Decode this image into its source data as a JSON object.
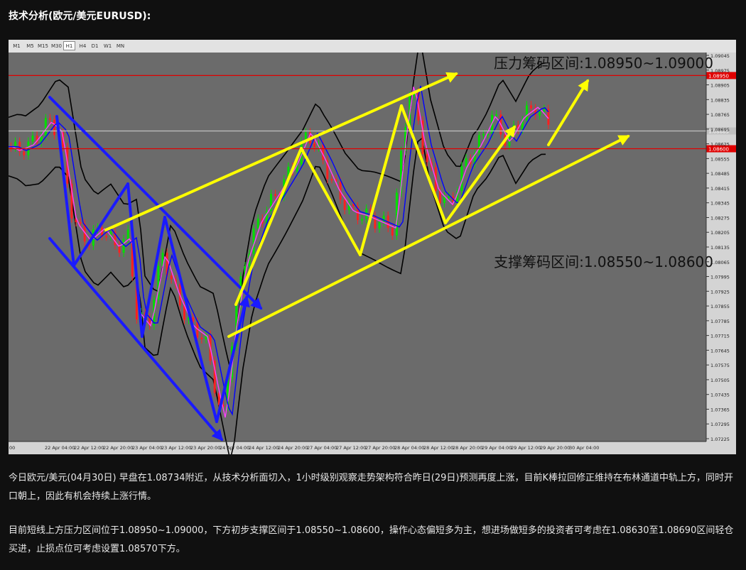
{
  "heading": "技术分析(欧元/美元EURUSD):",
  "timeframes": [
    {
      "label": "M1",
      "active": false
    },
    {
      "label": "M5",
      "active": false
    },
    {
      "label": "M15",
      "active": false
    },
    {
      "label": "M30",
      "active": false
    },
    {
      "label": "H1",
      "active": true
    },
    {
      "label": "H4",
      "active": false
    },
    {
      "label": "D1",
      "active": false
    },
    {
      "label": "W1",
      "active": false
    },
    {
      "label": "MN",
      "active": false
    }
  ],
  "chart_data": {
    "type": "line",
    "resistance_label": "压力筹码区间:1.08950~1.09000",
    "support_label": "支撑筹码区间:1.08550~1.08600",
    "price_ticks": [
      "1.09045",
      "1.08975",
      "1.08905",
      "1.08835",
      "1.08765",
      "1.08695",
      "1.08625",
      "1.08555",
      "1.08485",
      "1.08415",
      "1.08345",
      "1.08275",
      "1.08205",
      "1.08135",
      "1.08065",
      "1.07995",
      "1.07925",
      "1.07855",
      "1.07785",
      "1.07715",
      "1.07645",
      "1.07575",
      "1.07505",
      "1.07435",
      "1.07365",
      "1.07295",
      "1.07225"
    ],
    "y_range": [
      1.072,
      1.0906
    ],
    "time_ticks": [
      "00",
      "22 Apr 04:00",
      "22 Apr 12:00",
      "22 Apr 20:00",
      "23 Apr 04:00",
      "23 Apr 12:00",
      "23 Apr 20:00",
      "24 Apr 04:00",
      "24 Apr 12:00",
      "24 Apr 20:00",
      "27 Apr 04:00",
      "27 Apr 12:00",
      "27 Apr 20:00",
      "28 Apr 04:00",
      "28 Apr 12:00",
      "28 Apr 20:00",
      "29 Apr 04:00",
      "29 Apr 12:00",
      "29 Apr 20:00",
      "30 Apr 04:00"
    ],
    "hlines": [
      {
        "price": 1.0895,
        "label": "1.08950",
        "color": "#e00000"
      },
      {
        "price": 1.086,
        "label": "1.08600",
        "color": "#e00000"
      },
      {
        "price": 1.08685,
        "label": "1.08685",
        "color": "#c0c0c0"
      }
    ],
    "colors": {
      "up": "#00e000",
      "down": "#ff2020",
      "ma_fast": "#ff40ff",
      "ma_slow": "#0000ff",
      "band": "#000000",
      "arrow_down": "#1a1aff",
      "arrow_up": "#ffff00",
      "background": "#6b6b6b"
    }
  },
  "paragraphs": [
    "今日欧元/美元(04月30日) 早盘在1.08734附近，从技术分析面切入，1小时级别观察走势架构符合昨日(29日)预测再度上涨，目前K棒拉回修正维持在布林通道中轨上方，同时开口朝上，因此有机会持续上涨行情。",
    "目前短线上方压力区间位于1.08950~1.09000，下方初步支撑区间于1.08550~1.08600，操作心态偏短多为主，想进场做短多的投资者可考虑在1.08630至1.08690区间轻仓买进，止损点位可考虑设置1.08570下方。"
  ]
}
